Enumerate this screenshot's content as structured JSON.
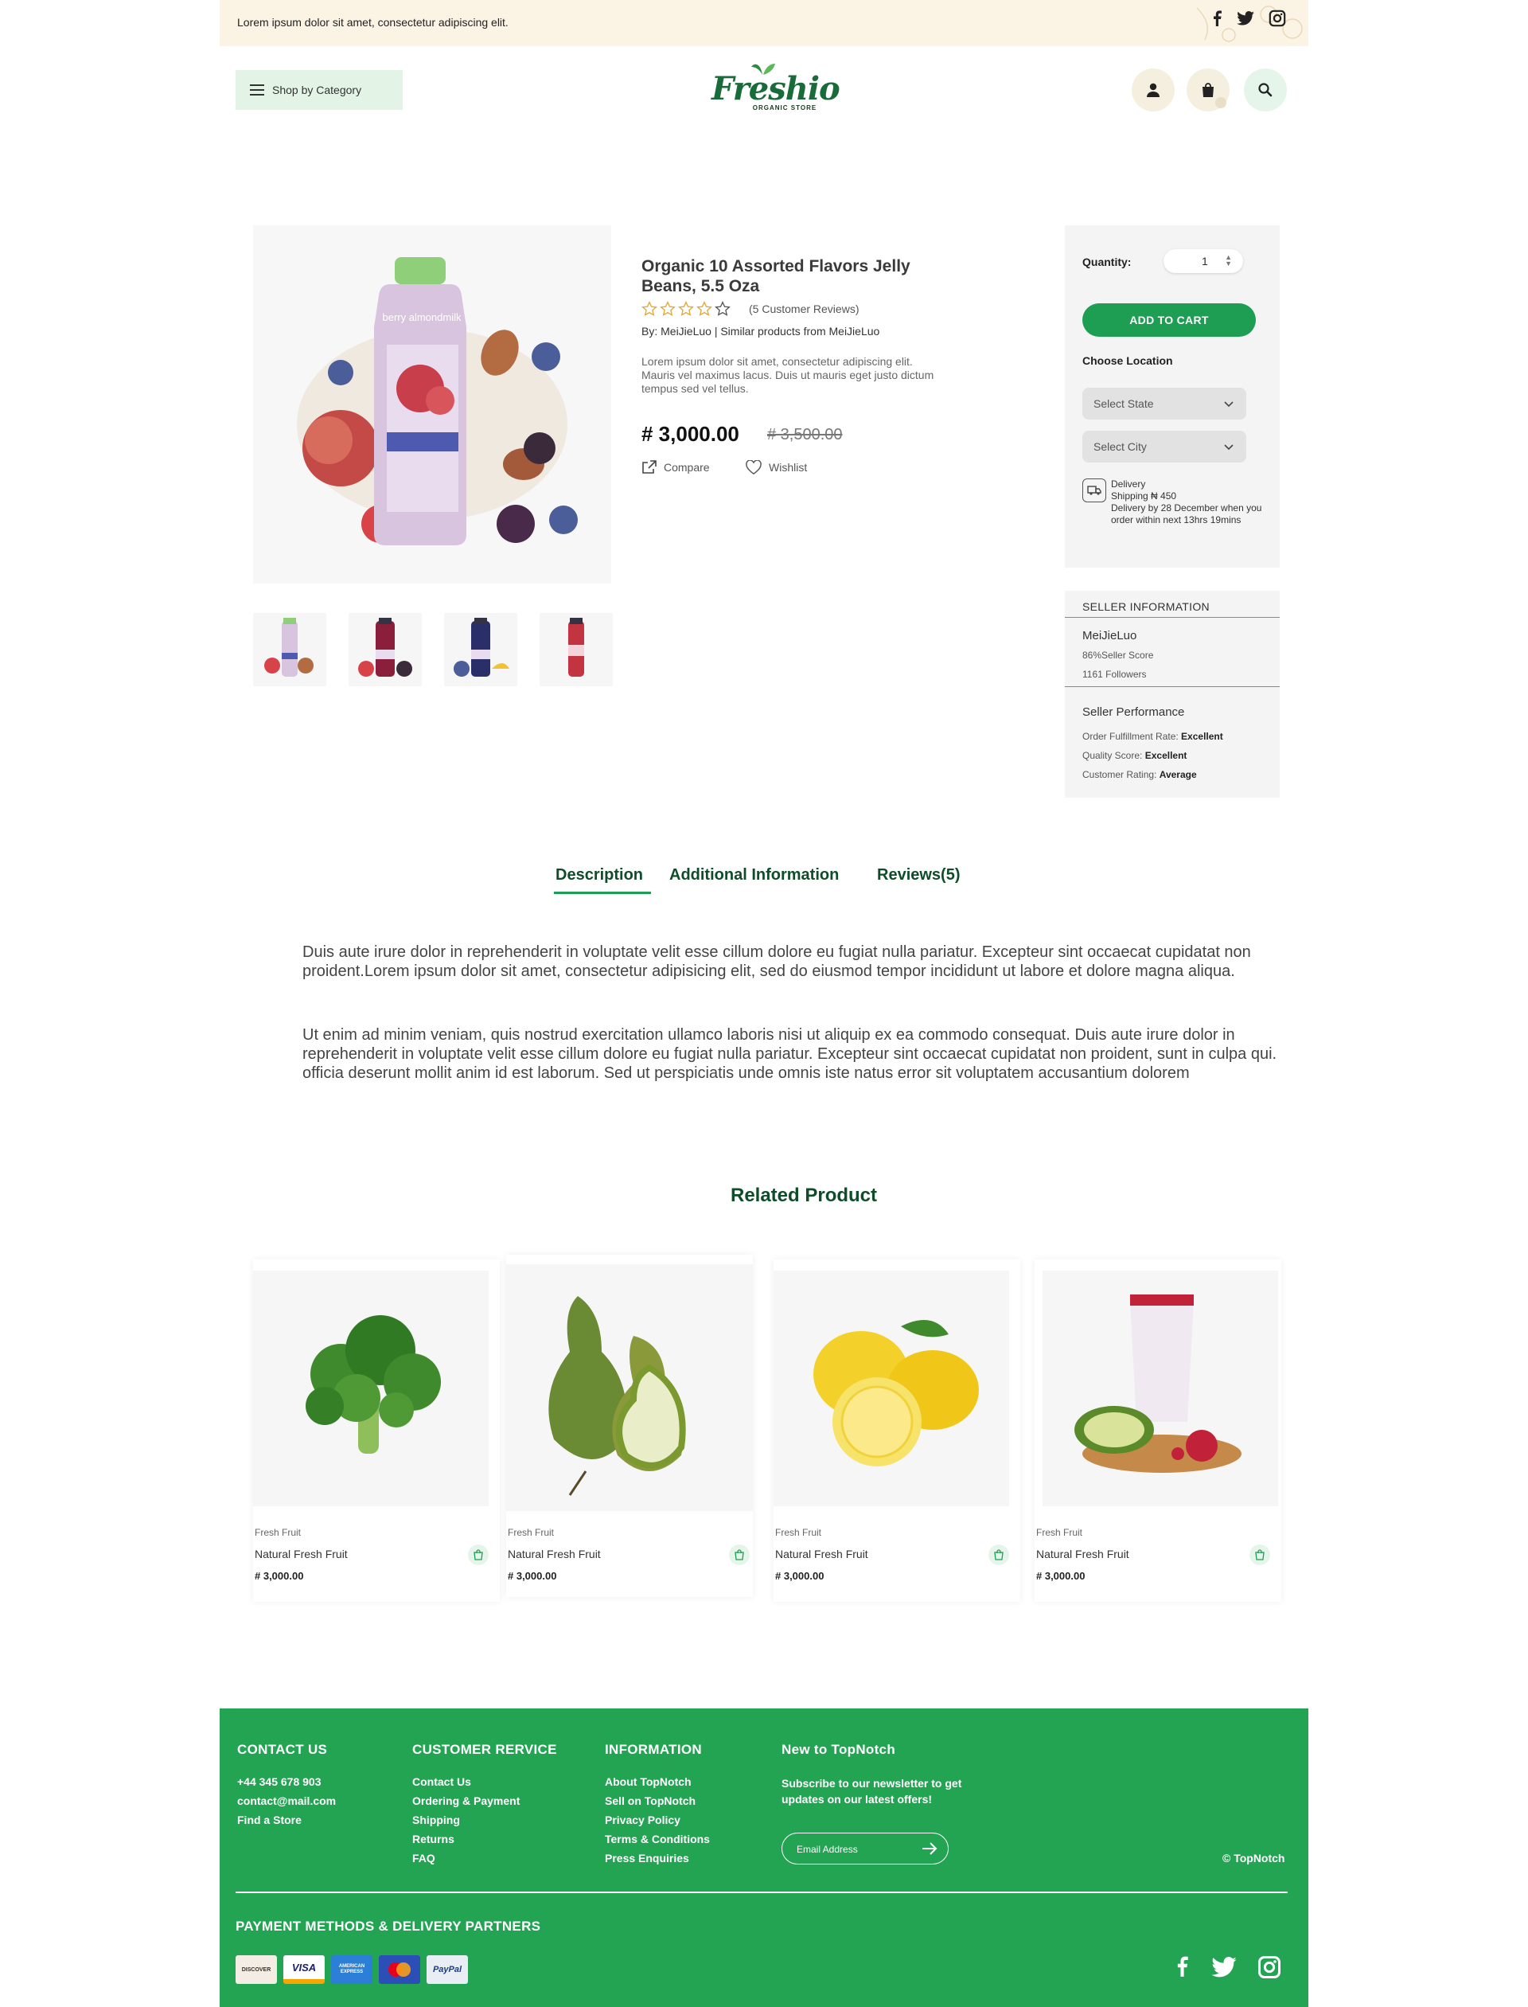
{
  "topbar": {
    "message": "Lorem ipsum dolor sit amet, consectetur adipiscing elit."
  },
  "header": {
    "shop_by_category": "Shop by Category",
    "logo_text": "Freshio",
    "logo_sub": "ORGANIC STORE",
    "cart_count": "0"
  },
  "product": {
    "title": "Organic 10 Assorted Flavors Jelly Beans, 5.5 Oza",
    "rating": 0,
    "reviews": "(5 Customer Reviews)",
    "by": "By: MeiJieLuo | Similar products from MeiJieLuo",
    "description": "Lorem ipsum dolor sit amet, consectetur adipiscing elit. Mauris vel maximus lacus. Duis ut mauris eget justo dictum tempus sed vel tellus.",
    "price": "# 3,000.00",
    "old_price": "# 3,500.00",
    "compare": "Compare",
    "wishlist": "Wishlist",
    "image_label": "berry almondmilk"
  },
  "buybox": {
    "quantity_label": "Quantity:",
    "quantity_value": "1",
    "add_to_cart": "ADD TO CART",
    "choose_location": "Choose Location",
    "select_state": "Select State",
    "select_city": "Select City",
    "delivery_title": "Delivery",
    "delivery_shipping": "Shipping ₦ 450",
    "delivery_note": "Delivery by 28 December when you order within next 13hrs 19mins"
  },
  "seller": {
    "heading": "SELLER INFORMATION",
    "name": "MeiJieLuo",
    "score": "86%Seller Score",
    "followers": "1161 Followers",
    "performance_title": "Seller Performance",
    "fulfillment_label": "Order Fulfillment Rate:",
    "fulfillment_value": "Excellent",
    "quality_label": "Quality Score:",
    "quality_value": "Excellent",
    "rating_label": "Customer Rating:",
    "rating_value": "Average"
  },
  "tabs": [
    {
      "label": "Description"
    },
    {
      "label": "Additional Information"
    },
    {
      "label": "Reviews(5)"
    }
  ],
  "description": {
    "p1": "Duis aute irure dolor in reprehenderit in voluptate velit esse cillum dolore eu fugiat nulla pariatur. Excepteur sint occaecat cupidatat non proident.Lorem ipsum dolor sit amet, consectetur adipisicing elit, sed do eiusmod tempor incididunt ut labore et dolore magna aliqua.",
    "p2": "Ut enim ad minim veniam, quis nostrud exercitation ullamco laboris nisi ut aliquip ex ea commodo consequat. Duis aute irure dolor in reprehenderit in voluptate velit esse cillum dolore eu fugiat nulla pariatur. Excepteur sint occaecat cupidatat non proident, sunt in culpa qui. officia deserunt mollit anim id est laborum. Sed ut perspiciatis unde omnis iste natus error sit voluptatem accusantium dolorem"
  },
  "related": {
    "title": "Related Product",
    "items": [
      {
        "category": "Fresh Fruit",
        "name": "Natural Fresh Fruit",
        "price": "# 3,000.00",
        "image": "broccoli"
      },
      {
        "category": "Fresh Fruit",
        "name": "Natural Fresh Fruit",
        "price": "# 3,000.00",
        "image": "pears"
      },
      {
        "category": "Fresh Fruit",
        "name": "Natural Fresh Fruit",
        "price": "# 3,000.00",
        "image": "lemons"
      },
      {
        "category": "Fresh Fruit",
        "name": "Natural Fresh Fruit",
        "price": "# 3,000.00",
        "image": "avocado-pomegranate-drink"
      }
    ]
  },
  "footer": {
    "contact_heading": "CONTACT US",
    "contact": [
      "+44 345 678 903",
      "contact@mail.com",
      "Find a Store"
    ],
    "service_heading": "CUSTOMER RERVICE",
    "service": [
      "Contact Us",
      "Ordering & Payment",
      "Shipping",
      "Returns",
      "FAQ"
    ],
    "info_heading": "INFORMATION",
    "info": [
      "About TopNotch",
      "Sell on TopNotch",
      "Privacy Policy",
      "Terms & Conditions",
      "Press Enquiries"
    ],
    "newsletter_heading": "New to TopNotch",
    "newsletter_text": "Subscribe to our newsletter to get updates on our latest offers!",
    "email_placeholder": "Email Address",
    "copyright": "© TopNotch",
    "payment_heading": "PAYMENT METHODS & DELIVERY PARTNERS",
    "payment_cards": [
      "DISCOVER",
      "VISA",
      "AMERICAN EXPRESS",
      "mastercard",
      "PayPal"
    ]
  },
  "colors": {
    "brand_green": "#23a453",
    "dark_green": "#0f4d2a",
    "button_green": "#1e9e52"
  }
}
